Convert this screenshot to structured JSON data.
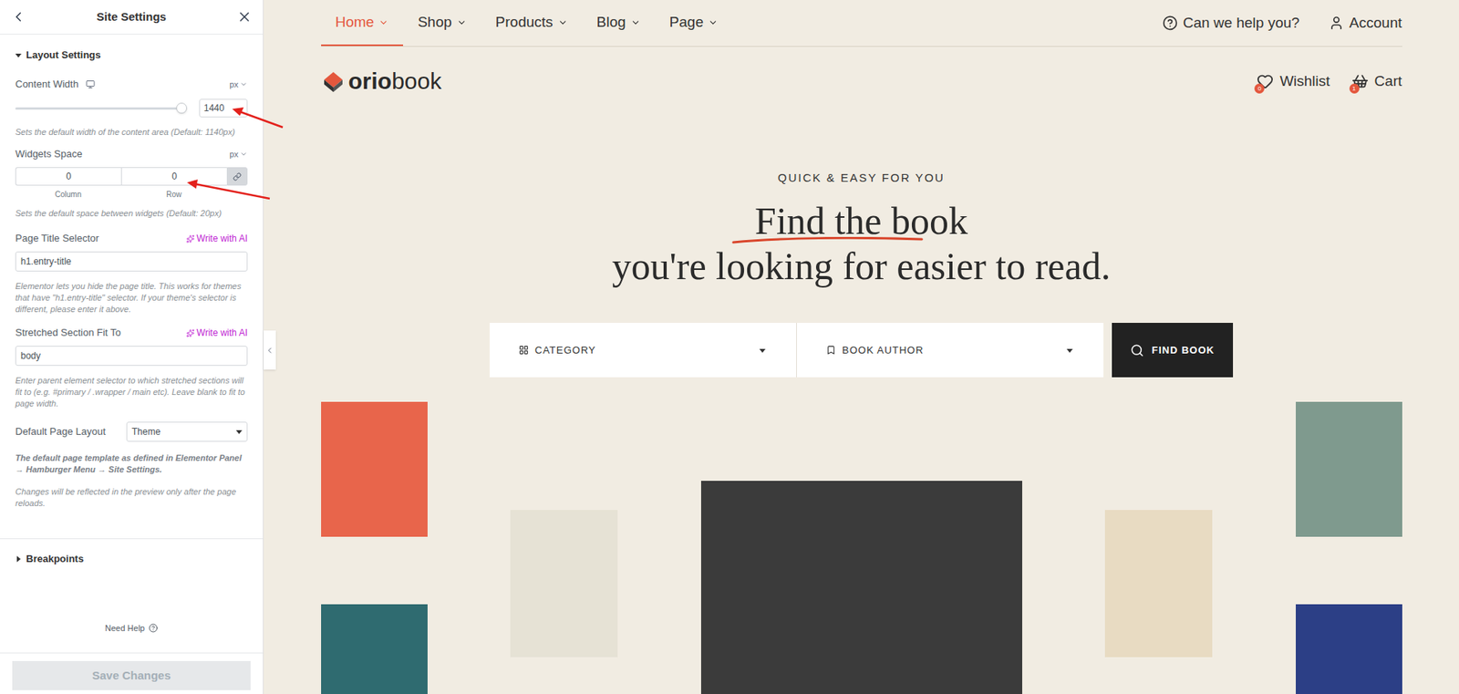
{
  "panel": {
    "title": "Site Settings",
    "section": {
      "label": "Layout Settings",
      "expanded": true
    },
    "content_width": {
      "label": "Content Width",
      "unit": "px",
      "value": "1440",
      "level": 0.97,
      "help": "Sets the default width of the content area (Default: 1140px)"
    },
    "widgets_space": {
      "label": "Widgets Space",
      "unit": "px",
      "linked": true,
      "fields": [
        {
          "label": "Column",
          "value": "0"
        },
        {
          "label": "Row",
          "value": "0"
        }
      ],
      "help": "Sets the default space between widgets (Default: 20px)"
    },
    "page_title_selector": {
      "label": "Page Title Selector",
      "ai": "Write with AI",
      "value": "h1.entry-title",
      "help": "Elementor lets you hide the page title. This works for themes that have \"h1.entry-title\" selector. If your theme's selector is different, please enter it above."
    },
    "stretched_section": {
      "label": "Stretched Section Fit To",
      "ai": "Write with AI",
      "value": "body",
      "help": "Enter parent element selector to which stretched sections will fit to (e.g. #primary / .wrapper / main etc). Leave blank to fit to page width."
    },
    "page_layout": {
      "label": "Default Page Layout",
      "value": "Theme",
      "note": "The default page template as defined in Elementor Panel → Hamburger Menu → Site Settings.",
      "help": "Changes will be reflected in the preview only after the page reloads."
    },
    "breakpoints": {
      "label": "Breakpoints",
      "expanded": false
    },
    "need_help": "Need Help",
    "save": {
      "label": "Save Changes",
      "disabled": true
    }
  },
  "preview": {
    "nav": [
      {
        "label": "Home",
        "selected": true
      },
      {
        "label": "Shop",
        "selected": false
      },
      {
        "label": "Products",
        "selected": false
      },
      {
        "label": "Blog",
        "selected": false
      },
      {
        "label": "Page",
        "selected": false
      }
    ],
    "help": "Can we help you?",
    "account": "Account",
    "logo": {
      "bold": "orio",
      "light": "book"
    },
    "wishlist": {
      "label": "Wishlist",
      "count": "0"
    },
    "cart": {
      "label": "Cart",
      "count": "1"
    },
    "hero": {
      "eyebrow": "QUICK & EASY FOR YOU",
      "highlight": "Find the book",
      "line2": "you're looking for easier to read."
    },
    "search": {
      "fields": [
        "CATEGORY",
        "BOOK AUTHOR"
      ],
      "button": "FIND BOOK"
    },
    "books": [
      {
        "color": "#e8654b"
      },
      {
        "color": "#2f6b70"
      },
      {
        "color": "#e6e2d5"
      },
      {
        "color": "#3b3b3b"
      },
      {
        "color": "#e8dbc2"
      },
      {
        "color": "#7f9a8e"
      },
      {
        "color": "#2c3f86"
      }
    ]
  }
}
